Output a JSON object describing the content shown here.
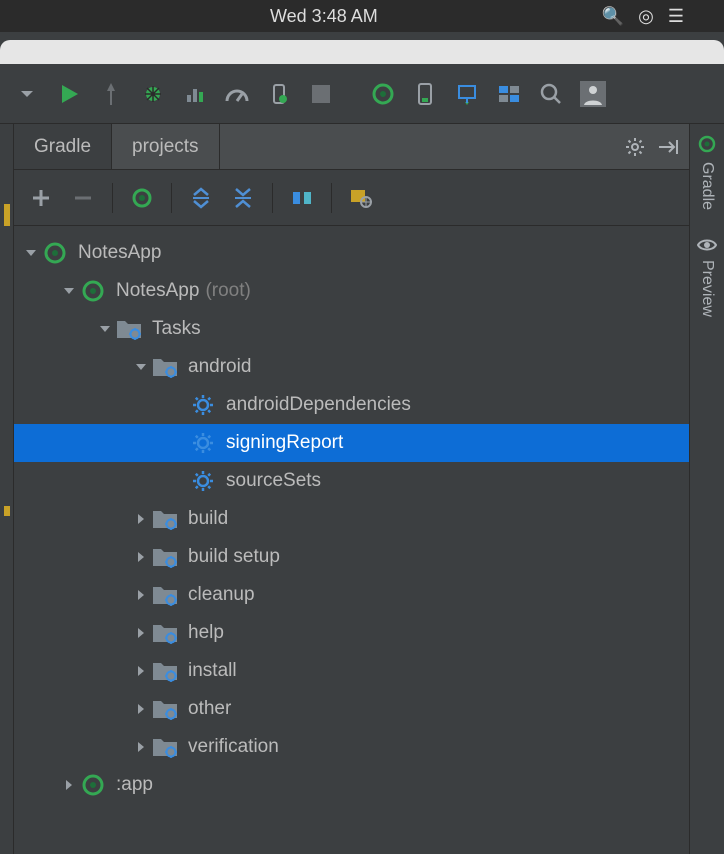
{
  "osbar": {
    "time": "Wed 3:48 AM"
  },
  "tabs": {
    "gradle": "Gradle",
    "projects": "projects"
  },
  "tree": {
    "root": {
      "name": "NotesApp",
      "module": {
        "name": "NotesApp",
        "suffix": "(root)",
        "tasks_label": "Tasks",
        "groups": {
          "android": {
            "label": "android",
            "tasks": [
              "androidDependencies",
              "signingReport",
              "sourceSets"
            ]
          },
          "build": {
            "label": "build"
          },
          "build_setup": {
            "label": "build setup"
          },
          "cleanup": {
            "label": "cleanup"
          },
          "help": {
            "label": "help"
          },
          "install": {
            "label": "install"
          },
          "other": {
            "label": "other"
          },
          "verification": {
            "label": "verification"
          }
        }
      },
      "app": ":app"
    }
  },
  "selected_task": "signingReport",
  "rightstrip": {
    "gradle": "Gradle",
    "preview": "Preview"
  },
  "colors": {
    "selection": "#0d6dd6",
    "accent_green": "#34a853",
    "folder": "#7f8a93",
    "gear_blue": "#3a8de0"
  }
}
